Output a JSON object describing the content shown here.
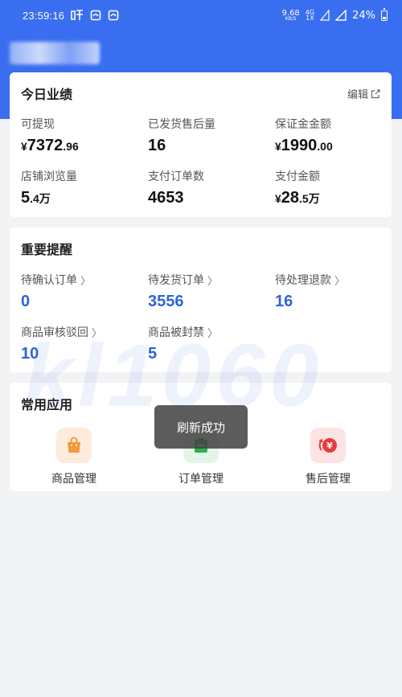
{
  "status_bar": {
    "time": "23:59:16",
    "speed_top": "9.68",
    "speed_bottom": "KB/S",
    "net_top": "4G",
    "net_bottom": "1X",
    "battery": "24%"
  },
  "today_perf": {
    "title": "今日业绩",
    "edit_label": "编辑",
    "items": [
      {
        "label": "可提现",
        "cur": "¥",
        "main": "7372",
        "small": ".96"
      },
      {
        "label": "已发货售后量",
        "cur": "",
        "main": "16",
        "small": ""
      },
      {
        "label": "保证金金额",
        "cur": "¥",
        "main": "1990",
        "small": ".00"
      },
      {
        "label": "店铺浏览量",
        "cur": "",
        "main": "5",
        "small": ".4万"
      },
      {
        "label": "支付订单数",
        "cur": "",
        "main": "4653",
        "small": ""
      },
      {
        "label": "支付金额",
        "cur": "¥",
        "main": "28",
        "small": ".5万"
      }
    ]
  },
  "reminders": {
    "title": "重要提醒",
    "items": [
      {
        "label": "待确认订单",
        "value": "0"
      },
      {
        "label": "待发货订单",
        "value": "3556"
      },
      {
        "label": "待处理退款",
        "value": "16"
      },
      {
        "label": "商品审核驳回",
        "value": "10"
      },
      {
        "label": "商品被封禁",
        "value": "5"
      }
    ]
  },
  "common_apps": {
    "title": "常用应用",
    "items": [
      {
        "label": "商品管理",
        "icon": "shopping-bag-icon",
        "bg": "#fdebdc",
        "color": "#f39a3b"
      },
      {
        "label": "订单管理",
        "icon": "clipboard-icon",
        "bg": "#e2f5e6",
        "color": "#2fae4f"
      },
      {
        "label": "售后管理",
        "icon": "refund-yen-icon",
        "bg": "#fde3e3",
        "color": "#e53b3b"
      }
    ]
  },
  "watermark": "kl1060",
  "toast": "刷新成功",
  "colors": {
    "header": "#3a6ef0",
    "accent_blue": "#2f63d8"
  }
}
